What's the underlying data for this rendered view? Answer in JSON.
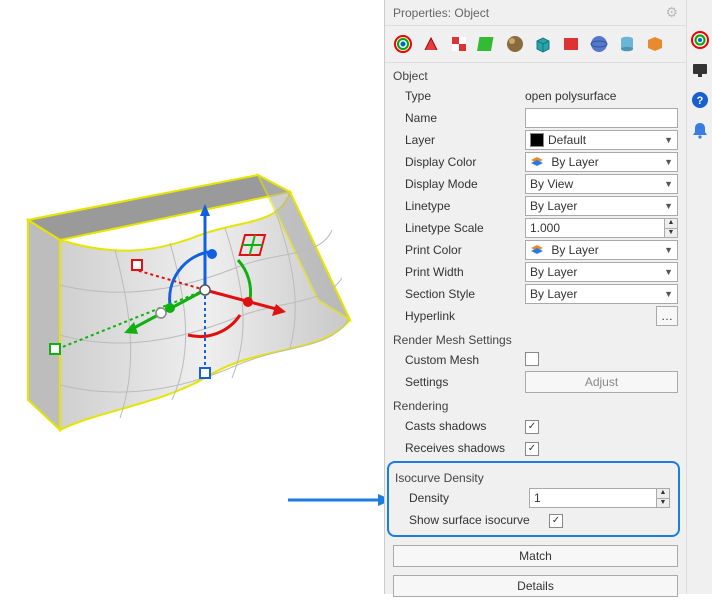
{
  "panel": {
    "title": "Properties: Object"
  },
  "object": {
    "heading": "Object",
    "type_label": "Type",
    "type_value": "open polysurface",
    "name_label": "Name",
    "name_value": "",
    "layer_label": "Layer",
    "layer_value": "Default",
    "displaycolor_label": "Display Color",
    "displaycolor_value": "By Layer",
    "displaymode_label": "Display Mode",
    "displaymode_value": "By View",
    "linetype_label": "Linetype",
    "linetype_value": "By Layer",
    "linetypescale_label": "Linetype Scale",
    "linetypescale_value": "1.000",
    "printcolor_label": "Print Color",
    "printcolor_value": "By Layer",
    "printwidth_label": "Print Width",
    "printwidth_value": "By Layer",
    "sectionstyle_label": "Section Style",
    "sectionstyle_value": "By Layer",
    "hyperlink_label": "Hyperlink"
  },
  "rendermesh": {
    "heading": "Render Mesh Settings",
    "custommesh_label": "Custom Mesh",
    "settings_label": "Settings",
    "adjust_label": "Adjust"
  },
  "rendering": {
    "heading": "Rendering",
    "casts_label": "Casts shadows",
    "receives_label": "Receives shadows"
  },
  "isocurve": {
    "heading": "Isocurve Density",
    "density_label": "Density",
    "density_value": "1",
    "show_label": "Show surface isocurve"
  },
  "buttons": {
    "match": "Match",
    "details": "Details"
  }
}
